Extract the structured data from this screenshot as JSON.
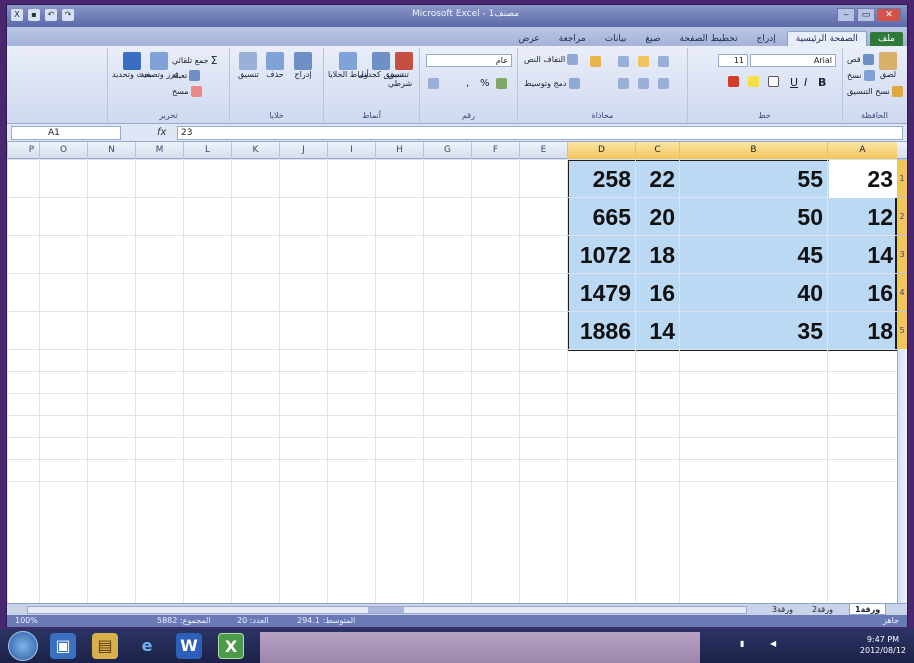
{
  "window": {
    "title": "Microsoft Excel - مصنف1",
    "controls": [
      "‒",
      "▭",
      "✕"
    ]
  },
  "ribbon": {
    "tabs": [
      "ملف",
      "الصفحة الرئيسية",
      "إدراج",
      "تخطيط الصفحة",
      "صيغ",
      "بيانات",
      "مراجعة",
      "عرض"
    ],
    "active_tab": "الصفحة الرئيسية",
    "groups": {
      "clipboard": {
        "label": "الحافظة",
        "paste": "لصق",
        "cut": "قص",
        "copy": "نسخ",
        "format_painter": "نسخ التنسيق"
      },
      "font": {
        "label": "خط",
        "font_name": "Arial",
        "font_size": "11",
        "bold": "B",
        "italic": "I",
        "underline": "U"
      },
      "alignment": {
        "label": "محاذاة",
        "wrap": "التفاف النص",
        "merge": "دمج وتوسيط"
      },
      "number": {
        "label": "رقم",
        "format": "عام",
        "percent": "%",
        "comma": ","
      },
      "styles": {
        "label": "أنماط",
        "conditional": "تنسيق شرطي",
        "as_table": "تنسيق كجدول",
        "cell_styles": "أنماط الخلايا"
      },
      "cells": {
        "label": "خلايا",
        "insert": "إدراج",
        "delete": "حذف",
        "format": "تنسيق"
      },
      "editing": {
        "label": "تحرير",
        "autosum": "جمع تلقائي",
        "fill": "تعبئة",
        "clear": "مسح",
        "sort": "فرز وتصفية",
        "find": "بحث وتحديد"
      }
    }
  },
  "formula_bar": {
    "name_box": "A1",
    "fx": "fx",
    "value": "23"
  },
  "sheet": {
    "columns": [
      "A",
      "B",
      "C",
      "D",
      "E",
      "F",
      "G",
      "H",
      "I",
      "J",
      "K",
      "L",
      "M",
      "N",
      "O",
      "P"
    ],
    "selected_columns": [
      "A",
      "B",
      "C",
      "D"
    ],
    "rows": [
      "1",
      "2",
      "3",
      "4",
      "5"
    ],
    "cells": [
      {
        "A": "23",
        "B": "55",
        "C": "22",
        "D": "258"
      },
      {
        "A": "12",
        "B": "50",
        "C": "20",
        "D": "665"
      },
      {
        "A": "14",
        "B": "45",
        "C": "18",
        "D": "1072"
      },
      {
        "A": "16",
        "B": "40",
        "C": "16",
        "D": "1479"
      },
      {
        "A": "18",
        "B": "35",
        "C": "14",
        "D": "1886"
      }
    ],
    "active_cell": "A1"
  },
  "sheet_tabs": [
    "ورقة1",
    "ورقة2",
    "ورقة3"
  ],
  "status_bar": {
    "mode": "جاهز",
    "average": "المتوسط: 294.1",
    "count": "العدد: 20",
    "sum": "المجموع: 5882",
    "zoom": "100%"
  },
  "taskbar": {
    "apps": [
      "ie-icon",
      "word-icon",
      "excel-icon"
    ],
    "clock_time": "9:47 PM",
    "clock_date": "2012/08/12"
  },
  "colors": {
    "selection_fill": "#bcd9f4",
    "header_highlight": "#f2c45c",
    "file_tab": "#2f7a3a"
  }
}
